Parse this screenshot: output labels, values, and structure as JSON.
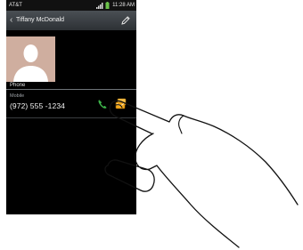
{
  "status_bar": {
    "carrier": "AT&T",
    "time": "11:28 AM"
  },
  "header": {
    "contact_name": "Tiffany McDonald"
  },
  "section": {
    "title": "Phone"
  },
  "phone_entry": {
    "label": "Mobile",
    "number": "(972) 555 -1234"
  },
  "colors": {
    "call_icon": "#3db34a",
    "message_icon": "#f2a81d",
    "title_bar": "#3b3f44"
  },
  "icons": {
    "back": "chevron-left-icon",
    "edit": "pencil-icon",
    "call": "phone-icon",
    "message": "message-icon"
  }
}
